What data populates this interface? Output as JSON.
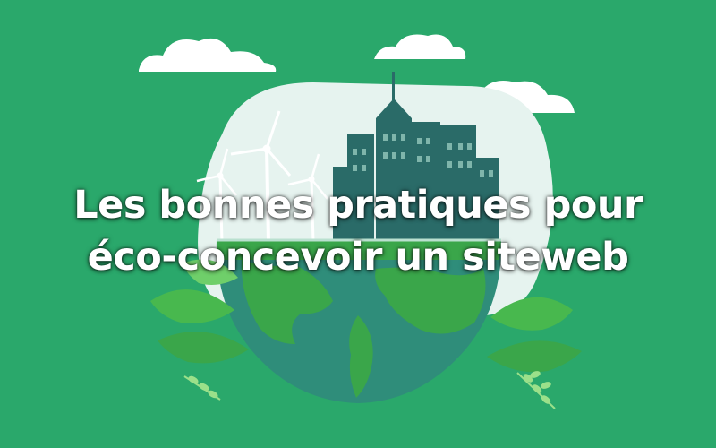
{
  "banner": {
    "headline_line_1": "Les bonnes pratiques pour",
    "headline_line_2": "éco-concevoir un siteweb"
  },
  "colors": {
    "background": "#2aa86b",
    "globe_ocean": "#2f8d7a",
    "land": "#3aa64a",
    "city": "#2a6b68",
    "cloud": "#ffffff",
    "headline_text": "#ffffff"
  },
  "icons": [
    "cloud-icon",
    "wind-turbine-icon",
    "city-buildings-icon",
    "globe-icon",
    "leaf-icon"
  ]
}
